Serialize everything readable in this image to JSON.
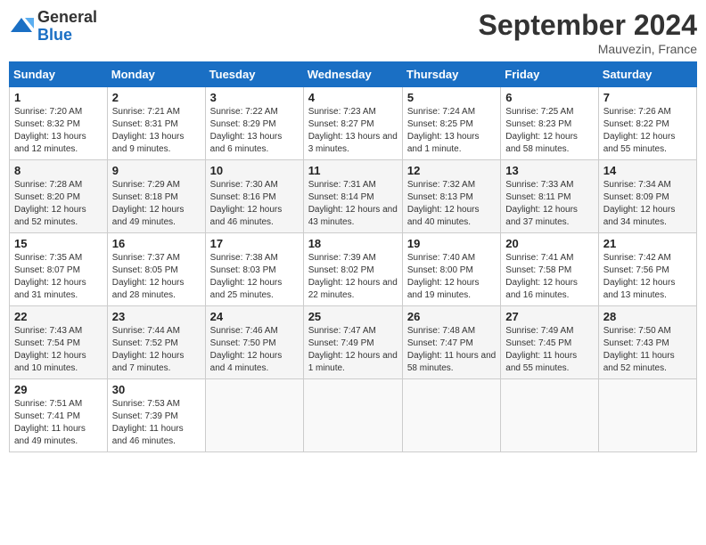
{
  "header": {
    "logo_general": "General",
    "logo_blue": "Blue",
    "month_title": "September 2024",
    "location": "Mauvezin, France"
  },
  "weekdays": [
    "Sunday",
    "Monday",
    "Tuesday",
    "Wednesday",
    "Thursday",
    "Friday",
    "Saturday"
  ],
  "weeks": [
    [
      {
        "day": "1",
        "sunrise": "7:20 AM",
        "sunset": "8:32 PM",
        "daylight": "13 hours and 12 minutes."
      },
      {
        "day": "2",
        "sunrise": "7:21 AM",
        "sunset": "8:31 PM",
        "daylight": "13 hours and 9 minutes."
      },
      {
        "day": "3",
        "sunrise": "7:22 AM",
        "sunset": "8:29 PM",
        "daylight": "13 hours and 6 minutes."
      },
      {
        "day": "4",
        "sunrise": "7:23 AM",
        "sunset": "8:27 PM",
        "daylight": "13 hours and 3 minutes."
      },
      {
        "day": "5",
        "sunrise": "7:24 AM",
        "sunset": "8:25 PM",
        "daylight": "13 hours and 1 minute."
      },
      {
        "day": "6",
        "sunrise": "7:25 AM",
        "sunset": "8:23 PM",
        "daylight": "12 hours and 58 minutes."
      },
      {
        "day": "7",
        "sunrise": "7:26 AM",
        "sunset": "8:22 PM",
        "daylight": "12 hours and 55 minutes."
      }
    ],
    [
      {
        "day": "8",
        "sunrise": "7:28 AM",
        "sunset": "8:20 PM",
        "daylight": "12 hours and 52 minutes."
      },
      {
        "day": "9",
        "sunrise": "7:29 AM",
        "sunset": "8:18 PM",
        "daylight": "12 hours and 49 minutes."
      },
      {
        "day": "10",
        "sunrise": "7:30 AM",
        "sunset": "8:16 PM",
        "daylight": "12 hours and 46 minutes."
      },
      {
        "day": "11",
        "sunrise": "7:31 AM",
        "sunset": "8:14 PM",
        "daylight": "12 hours and 43 minutes."
      },
      {
        "day": "12",
        "sunrise": "7:32 AM",
        "sunset": "8:13 PM",
        "daylight": "12 hours and 40 minutes."
      },
      {
        "day": "13",
        "sunrise": "7:33 AM",
        "sunset": "8:11 PM",
        "daylight": "12 hours and 37 minutes."
      },
      {
        "day": "14",
        "sunrise": "7:34 AM",
        "sunset": "8:09 PM",
        "daylight": "12 hours and 34 minutes."
      }
    ],
    [
      {
        "day": "15",
        "sunrise": "7:35 AM",
        "sunset": "8:07 PM",
        "daylight": "12 hours and 31 minutes."
      },
      {
        "day": "16",
        "sunrise": "7:37 AM",
        "sunset": "8:05 PM",
        "daylight": "12 hours and 28 minutes."
      },
      {
        "day": "17",
        "sunrise": "7:38 AM",
        "sunset": "8:03 PM",
        "daylight": "12 hours and 25 minutes."
      },
      {
        "day": "18",
        "sunrise": "7:39 AM",
        "sunset": "8:02 PM",
        "daylight": "12 hours and 22 minutes."
      },
      {
        "day": "19",
        "sunrise": "7:40 AM",
        "sunset": "8:00 PM",
        "daylight": "12 hours and 19 minutes."
      },
      {
        "day": "20",
        "sunrise": "7:41 AM",
        "sunset": "7:58 PM",
        "daylight": "12 hours and 16 minutes."
      },
      {
        "day": "21",
        "sunrise": "7:42 AM",
        "sunset": "7:56 PM",
        "daylight": "12 hours and 13 minutes."
      }
    ],
    [
      {
        "day": "22",
        "sunrise": "7:43 AM",
        "sunset": "7:54 PM",
        "daylight": "12 hours and 10 minutes."
      },
      {
        "day": "23",
        "sunrise": "7:44 AM",
        "sunset": "7:52 PM",
        "daylight": "12 hours and 7 minutes."
      },
      {
        "day": "24",
        "sunrise": "7:46 AM",
        "sunset": "7:50 PM",
        "daylight": "12 hours and 4 minutes."
      },
      {
        "day": "25",
        "sunrise": "7:47 AM",
        "sunset": "7:49 PM",
        "daylight": "12 hours and 1 minute."
      },
      {
        "day": "26",
        "sunrise": "7:48 AM",
        "sunset": "7:47 PM",
        "daylight": "11 hours and 58 minutes."
      },
      {
        "day": "27",
        "sunrise": "7:49 AM",
        "sunset": "7:45 PM",
        "daylight": "11 hours and 55 minutes."
      },
      {
        "day": "28",
        "sunrise": "7:50 AM",
        "sunset": "7:43 PM",
        "daylight": "11 hours and 52 minutes."
      }
    ],
    [
      {
        "day": "29",
        "sunrise": "7:51 AM",
        "sunset": "7:41 PM",
        "daylight": "11 hours and 49 minutes."
      },
      {
        "day": "30",
        "sunrise": "7:53 AM",
        "sunset": "7:39 PM",
        "daylight": "11 hours and 46 minutes."
      },
      null,
      null,
      null,
      null,
      null
    ]
  ]
}
